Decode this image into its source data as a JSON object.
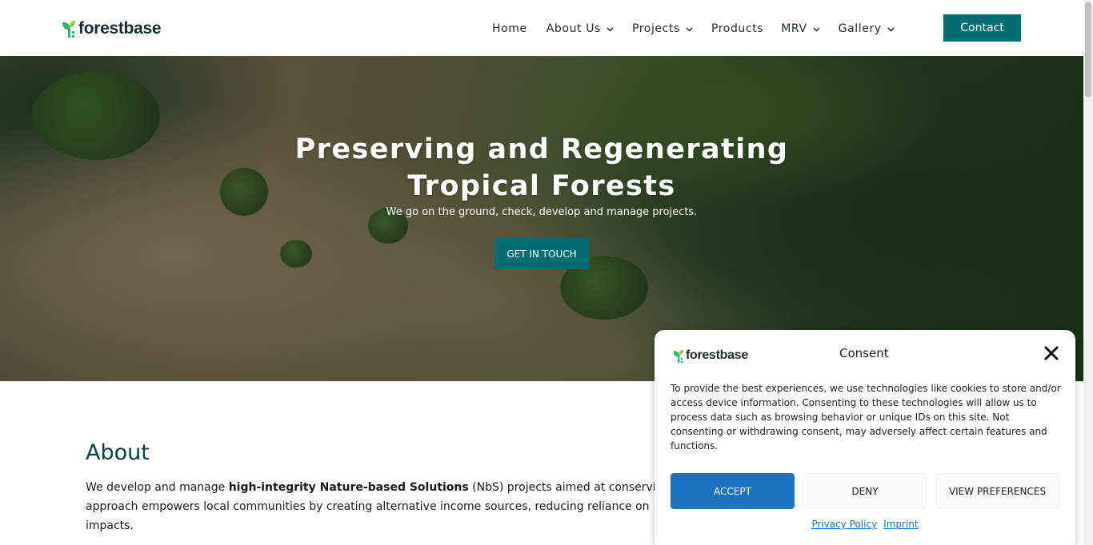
{
  "header": {
    "logo_text": "forestbase",
    "nav": [
      {
        "label": "Home"
      },
      {
        "label": "About Us"
      },
      {
        "label": "Projects"
      },
      {
        "label": "Products"
      },
      {
        "label": "MRV"
      },
      {
        "label": "Gallery"
      }
    ],
    "contact_label": "Contact"
  },
  "hero": {
    "title_line1": "Preserving and Regenerating",
    "title_line2": "Tropical Forests",
    "subtitle": "We go on the ground, check, develop and manage projects.",
    "cta_label": "GET IN TOUCH"
  },
  "about": {
    "heading": "About",
    "text_before": "We develop and manage ",
    "text_bold": "high-integrity Nature-based Solutions",
    "text_after_line1": " (NbS) projects aimed at conserving",
    "text_line2": "approach empowers local communities by creating alternative income sources, reducing reliance on",
    "text_line3": "impacts."
  },
  "consent": {
    "logo_text": "forestbase",
    "title": "Consent",
    "body": "To provide the best experiences, we use technologies like cookies to store and/or access device information. Consenting to these technologies will allow us to process data such as browsing behavior or unique IDs on this site. Not consenting or withdrawing consent, may adversely affect certain features and functions.",
    "accept_label": "ACCEPT",
    "deny_label": "DENY",
    "preferences_label": "VIEW PREFERENCES",
    "privacy_label": "Privacy Policy",
    "imprint_label": "Imprint"
  },
  "colors": {
    "brand_teal": "#006d73",
    "heading_teal": "#0a3e48",
    "accept_blue": "#1e73be",
    "logo_green": "#2bb673"
  },
  "icons": {
    "logo": "leaf-logo-icon",
    "dropdown": "chevron-down-icon",
    "close": "close-icon"
  }
}
